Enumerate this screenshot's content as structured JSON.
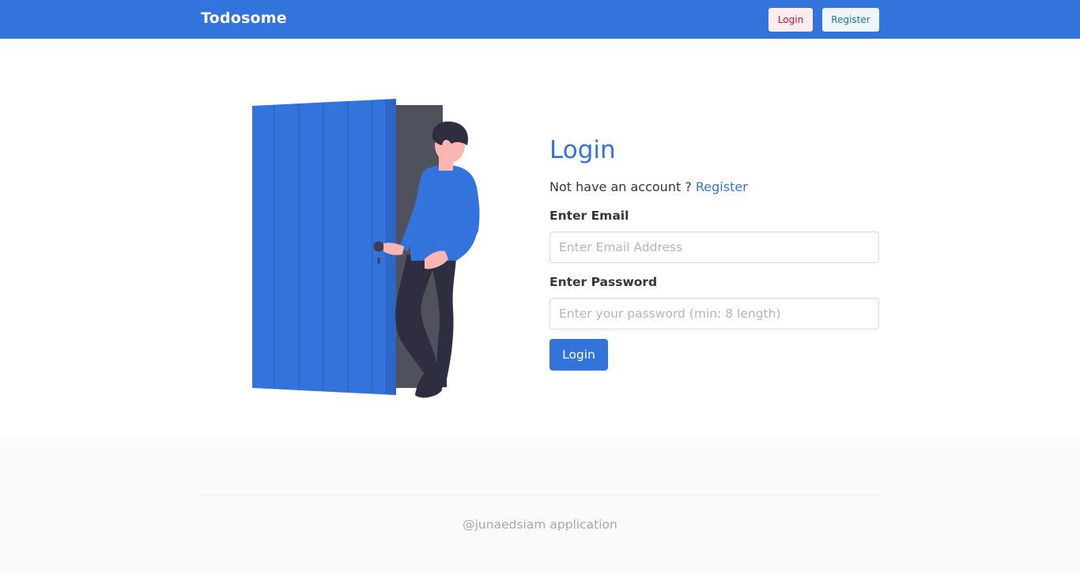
{
  "navbar": {
    "brand": "Todosome",
    "login_label": "Login",
    "register_label": "Register"
  },
  "form": {
    "title": "Login",
    "signup_prompt": "Not have an account ?",
    "signup_link": "Register",
    "email_label": "Enter Email",
    "email_placeholder": "Enter Email Address",
    "password_label": "Enter Password",
    "password_placeholder": "Enter your password (min: 8 length)",
    "submit_label": "Login"
  },
  "footer": {
    "text": "@junaedsiam application"
  },
  "colors": {
    "primary": "#3273dc",
    "danger_light": "#feecf0",
    "info_light": "#eef6fc"
  }
}
